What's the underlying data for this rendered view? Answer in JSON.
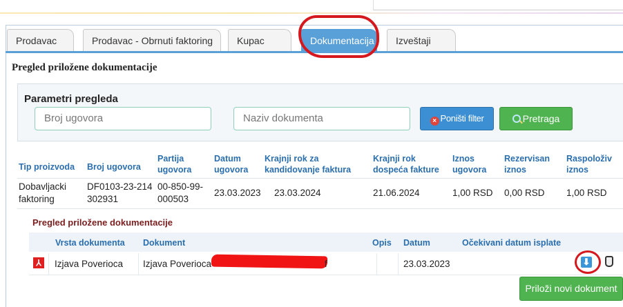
{
  "tabs": [
    {
      "label": "Prodavac"
    },
    {
      "label": "Prodavac - Obrnuti faktoring"
    },
    {
      "label": "Kupac"
    },
    {
      "label": "Dokumentacija"
    },
    {
      "label": "Izveštaji"
    }
  ],
  "active_tab": "Dokumentacija",
  "page_title": "Pregled priložene dokumentacije",
  "filters": {
    "title": "Parametri pregleda",
    "contract_placeholder": "Broj ugovora",
    "document_placeholder": "Naziv dokumenta",
    "reset_label": "Poništi filter",
    "search_label": "Pretraga"
  },
  "table": {
    "columns": [
      "Tip proizvoda",
      "Broj ugovora",
      "Partija ugovora",
      "Datum ugovora",
      "Krajnji rok za kandidovanje faktura",
      "Krajnji rok dospeća fakture",
      "Iznos ugovora",
      "Rezervisan iznos",
      "Raspoloživ iznos"
    ],
    "rows": [
      {
        "tip": "Dobavljacki faktoring",
        "broj": "DF0103-23-214302931",
        "partija": "00-850-99-000503",
        "datum": "23.03.2023",
        "rok_kandidovanje": "23.03.2024",
        "rok_dospeca": "21.06.2024",
        "iznos": "1,00 RSD",
        "rezervisan": "0,00 RSD",
        "raspoloziv": "1,00 RSD"
      }
    ]
  },
  "documents": {
    "title": "Pregled priložene dokumentacije",
    "columns": [
      "Vrsta dokumenta",
      "Dokument",
      "Opis",
      "Datum",
      "Očekivani datum isplate"
    ],
    "rows": [
      {
        "vrsta": "Izjava Poverioca",
        "dokument_prefix": "Izjava Poverioca",
        "dokument_suffix": "f",
        "opis": "",
        "datum": "23.03.2023",
        "isplata": ""
      }
    ],
    "attach_label": "Priloži novi dokument"
  },
  "icons": [
    "pdf-icon",
    "download-icon",
    "trash-icon",
    "clear-filter-icon",
    "search-icon"
  ],
  "colors": {
    "accent": "#5aa0d8",
    "button_blue": "#3d8fd4",
    "button_green": "#4fb34f",
    "header_text": "#2a6ead",
    "annotation": "#d5181e"
  }
}
